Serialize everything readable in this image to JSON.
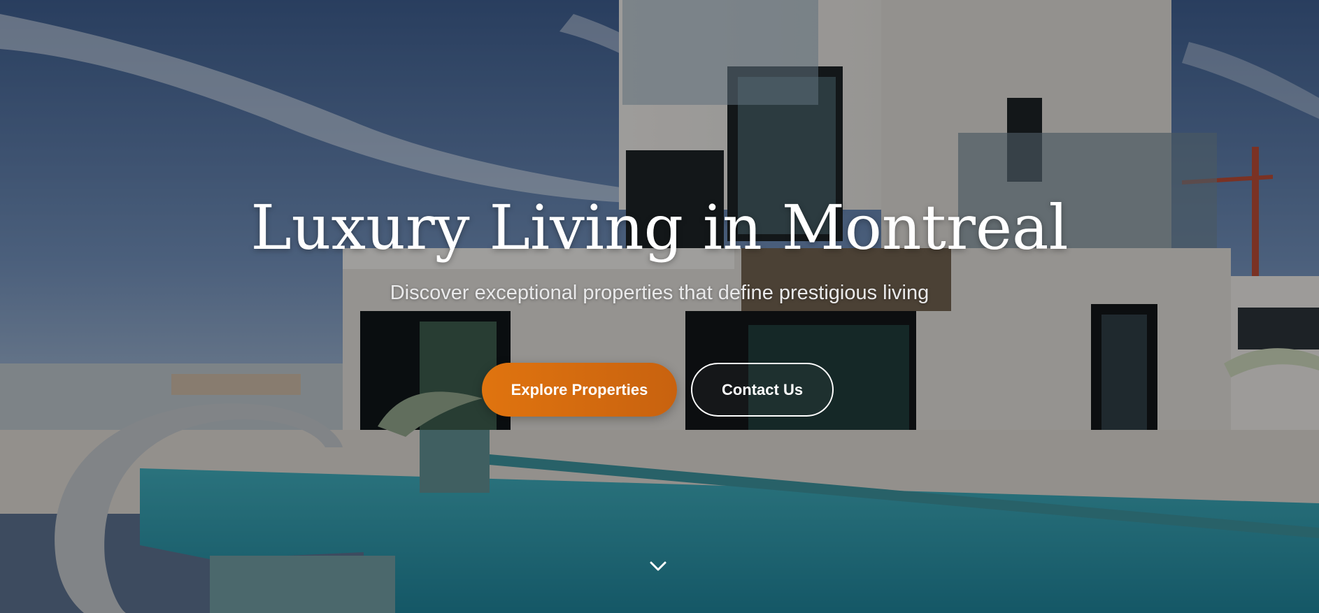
{
  "hero": {
    "title": "Luxury Living in Montreal",
    "subtitle": "Discover exceptional properties that define prestigious living",
    "primary_button_label": "Explore Properties",
    "secondary_button_label": "Contact Us",
    "scroll_icon": "chevron-down-icon",
    "background_image": "modern-white-villa-with-pool"
  },
  "colors": {
    "accent": "#e0740f",
    "text": "#ffffff",
    "sky": "#3f5f8f",
    "pool": "#2e93a6"
  }
}
